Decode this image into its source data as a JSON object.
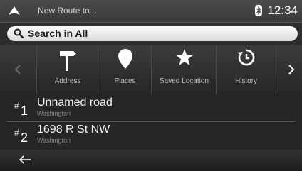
{
  "header": {
    "title": "New Route to...",
    "clock": "12:34",
    "icons": {
      "nav": "navigation-arrow-icon",
      "status": "bluetooth-icon"
    }
  },
  "search": {
    "label": "Search in All",
    "icon": "search-icon"
  },
  "categories": [
    {
      "label": "Address",
      "icon": "signpost-icon"
    },
    {
      "label": "Places",
      "icon": "location-pin-icon"
    },
    {
      "label": "Saved Location",
      "icon": "star-icon"
    },
    {
      "label": "History",
      "icon": "history-clock-icon"
    }
  ],
  "results": [
    {
      "hash": "#",
      "number": "1",
      "name": "Unnamed road",
      "subtitle": "Washington"
    },
    {
      "hash": "#",
      "number": "2",
      "name": "1698 R St NW",
      "subtitle": "Washington"
    }
  ],
  "footer": {
    "back_icon": "back-arrow-icon"
  },
  "colors": {
    "background": "#2b2b2b",
    "search_bar": "#f0f0f0",
    "text": "#ffffff"
  }
}
